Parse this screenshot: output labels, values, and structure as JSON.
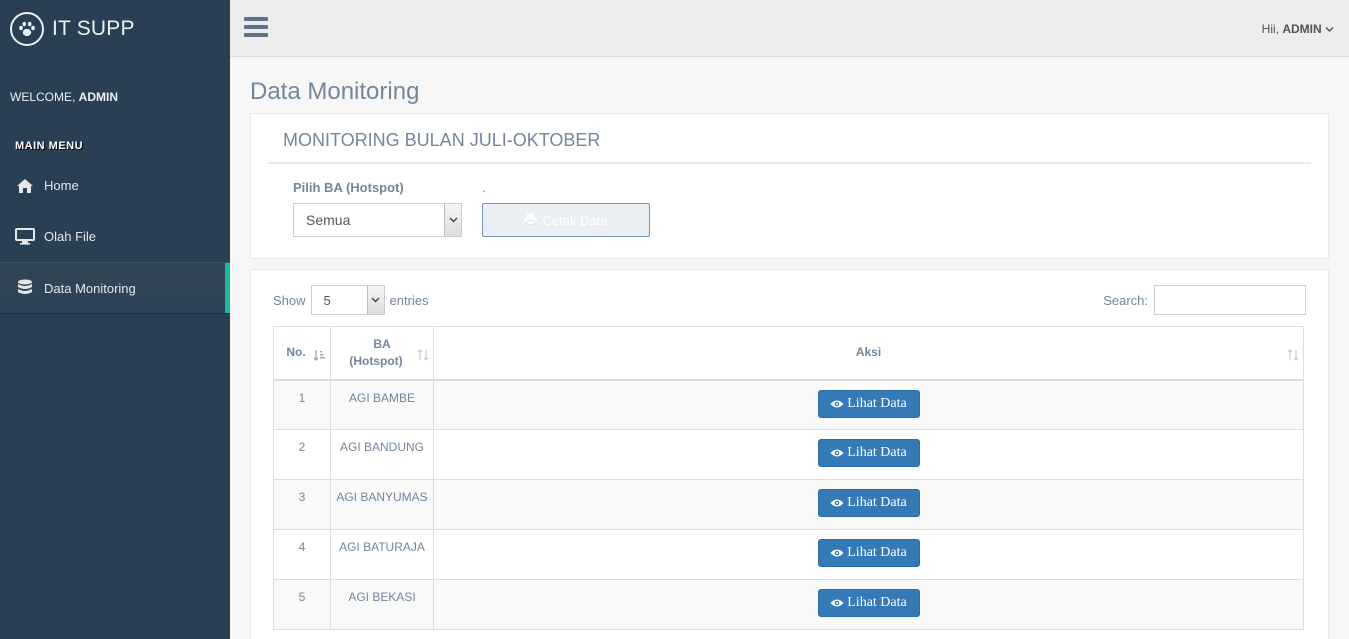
{
  "brand": {
    "title": "IT SUPP",
    "logo_icon": "paw-icon"
  },
  "sidebar": {
    "welcome_prefix": "WELCOME, ",
    "welcome_user": "ADMIN",
    "section_title": "MAIN MENU",
    "items": [
      {
        "label": "Home",
        "icon": "home-icon",
        "active": false
      },
      {
        "label": "Olah File",
        "icon": "desktop-icon",
        "active": false
      },
      {
        "label": "Data Monitoring",
        "icon": "database-icon",
        "active": true
      }
    ],
    "accent_color": "#1ABB9C"
  },
  "topnav": {
    "greeting": "Hii, ",
    "user": "ADMIN"
  },
  "page": {
    "title": "Data Monitoring",
    "panel_title": "MONITORING BULAN JULI-OKTOBER",
    "filter_label": "Pilih BA (Hotspot)",
    "filter_value": "Semua",
    "button_label_spacer": ".",
    "print_button": "Cetak Data"
  },
  "table_controls": {
    "show_label": "Show",
    "entries_value": "5",
    "entries_label": "entries",
    "search_label": "Search:",
    "search_value": ""
  },
  "table": {
    "headers": {
      "no": "No.",
      "ba_line1": "BA",
      "ba_line2": "(Hotspot)",
      "aksi": "Aksi"
    },
    "rows": [
      {
        "no": "1",
        "ba": "AGI BAMBE",
        "action": "Lihat Data"
      },
      {
        "no": "2",
        "ba": "AGI BANDUNG",
        "action": "Lihat Data"
      },
      {
        "no": "3",
        "ba": "AGI BANYUMAS",
        "action": "Lihat Data"
      },
      {
        "no": "4",
        "ba": "AGI BATURAJA",
        "action": "Lihat Data"
      },
      {
        "no": "5",
        "ba": "AGI BEKASI",
        "action": "Lihat Data"
      }
    ]
  }
}
